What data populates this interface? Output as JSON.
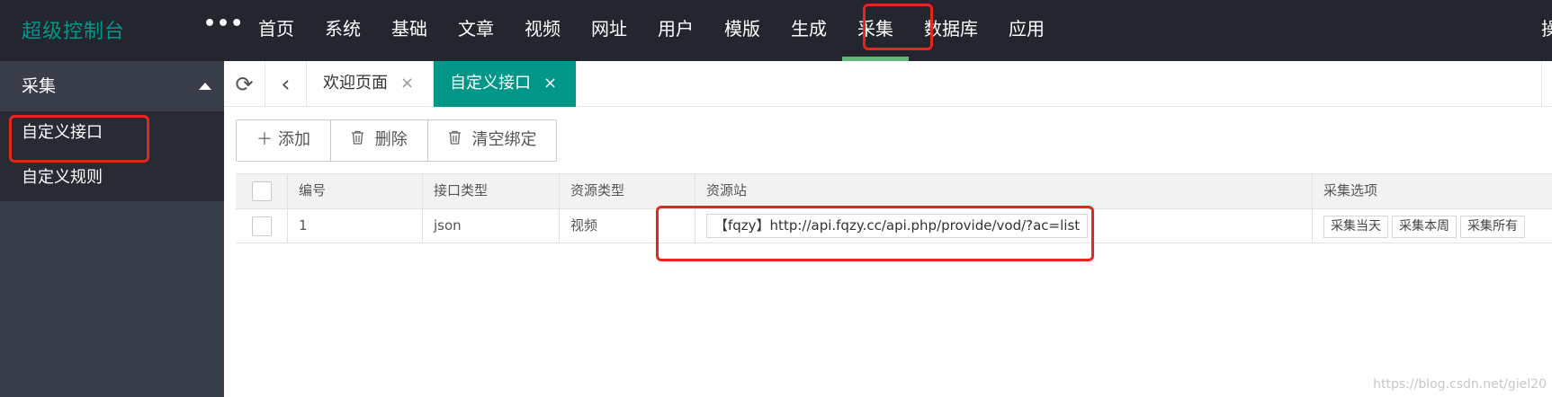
{
  "app": {
    "title": "超级控制台",
    "more": "•••"
  },
  "nav": {
    "items": [
      {
        "label": "首页"
      },
      {
        "label": "系统"
      },
      {
        "label": "基础"
      },
      {
        "label": "文章"
      },
      {
        "label": "视频"
      },
      {
        "label": "网址"
      },
      {
        "label": "用户"
      },
      {
        "label": "模版"
      },
      {
        "label": "生成"
      },
      {
        "label": "采集"
      },
      {
        "label": "数据库"
      },
      {
        "label": "应用"
      }
    ],
    "active": "采集",
    "right_label": "操作"
  },
  "sidebar": {
    "section_title": "采集",
    "items": [
      {
        "label": "自定义接口"
      },
      {
        "label": "自定义规则"
      }
    ]
  },
  "tabs": {
    "items": [
      {
        "label": "欢迎页面",
        "close": "×"
      },
      {
        "label": "自定义接口",
        "close": "×"
      }
    ]
  },
  "toolbar": {
    "add_icon": "＋",
    "add_label": "添加",
    "delete_label": "删除",
    "clear_label": "清空绑定"
  },
  "table": {
    "columns": [
      "编号",
      "接口类型",
      "资源类型",
      "资源站",
      "采集选项"
    ],
    "rows": [
      {
        "id": "1",
        "interface_type": "json",
        "resource_type": "视频",
        "site": "【fqzy】http://api.fqzy.cc/api.php/provide/vod/?ac=list",
        "options": [
          "采集当天",
          "采集本周",
          "采集所有"
        ]
      }
    ]
  },
  "watermark": "https://blog.csdn.net/giel20",
  "colors": {
    "accent": "#009688",
    "topbar": "#23262e",
    "sidebar": "#393d49",
    "annotation": "#e3271e"
  }
}
